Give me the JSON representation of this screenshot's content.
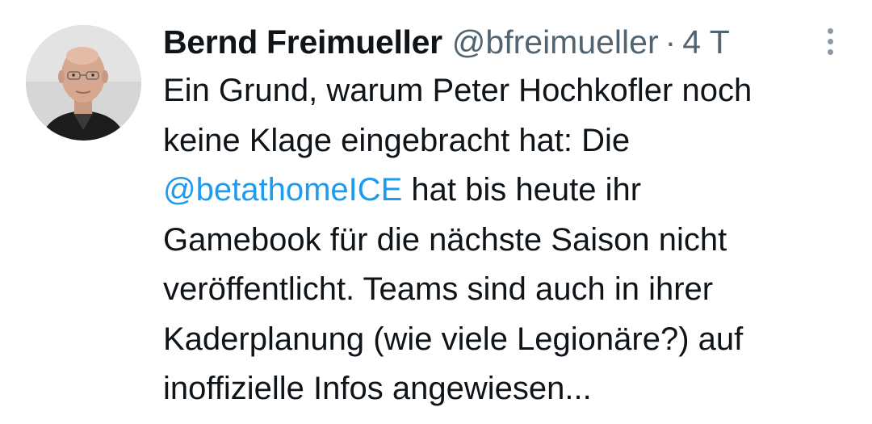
{
  "tweet": {
    "author": {
      "name": "Bernd Freimueller",
      "handle": "@bfreimueller",
      "avatar_icon": "person-avatar-icon"
    },
    "separator": "·",
    "time": "4 T",
    "more_icon": "more-vertical-icon",
    "body": {
      "line1": "Ein Grund, warum Peter Hochkofler noch",
      "line2": "keine Klage eingebracht hat: Die",
      "mention": "@betathomeICE",
      "line3_rest": " hat bis heute ihr",
      "line4": "Gamebook für die nächste Saison nicht",
      "line5": "veröffentlicht. Teams sind auch in ihrer",
      "line6": "Kaderplanung (wie viele Legionäre?) auf",
      "line7": "inoffizielle Infos angewiesen..."
    }
  },
  "colors": {
    "text": "#0f1419",
    "secondary": "#536471",
    "link": "#1d9bf0"
  }
}
